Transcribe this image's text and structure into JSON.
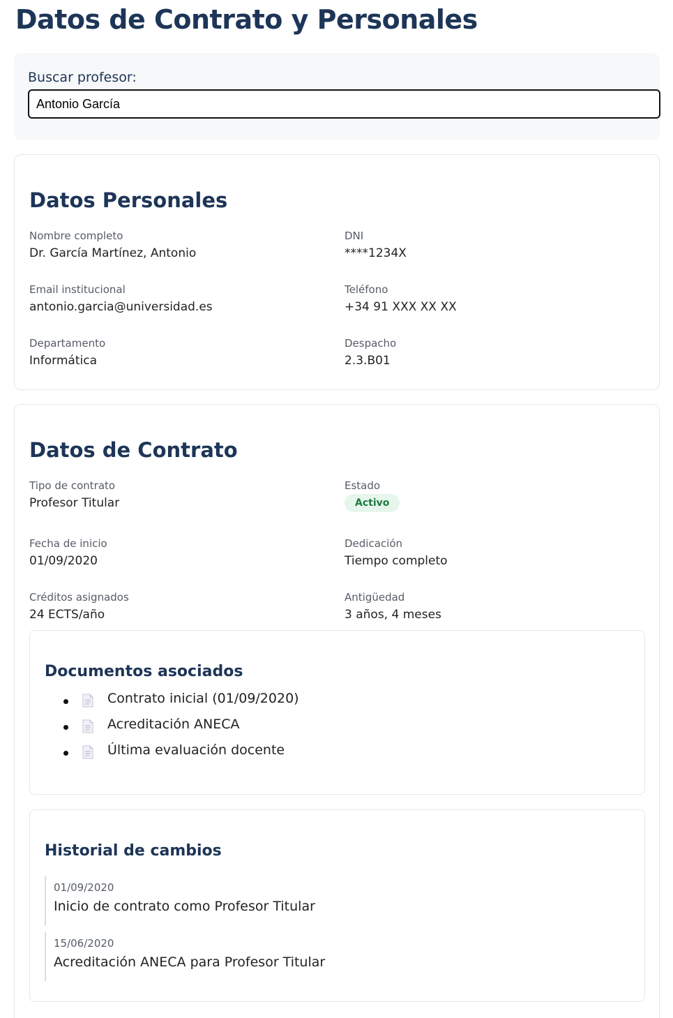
{
  "page": {
    "title": "Datos de Contrato y Personales"
  },
  "search": {
    "label": "Buscar profesor:",
    "value": "Antonio García"
  },
  "personal": {
    "title": "Datos Personales",
    "fields": [
      {
        "label": "Nombre completo",
        "value": "Dr. García Martínez, Antonio"
      },
      {
        "label": "DNI",
        "value": "****1234X"
      },
      {
        "label": "Email institucional",
        "value": "antonio.garcia@universidad.es"
      },
      {
        "label": "Teléfono",
        "value": "+34 91 XXX XX XX"
      },
      {
        "label": "Departamento",
        "value": "Informática"
      },
      {
        "label": "Despacho",
        "value": "2.3.B01"
      }
    ]
  },
  "contract": {
    "title": "Datos de Contrato",
    "tipo": {
      "label": "Tipo de contrato",
      "value": "Profesor Titular"
    },
    "estado": {
      "label": "Estado",
      "value": "Activo",
      "color": "#1f7a3f",
      "background": "#e6f6ec"
    },
    "fecha": {
      "label": "Fecha de inicio",
      "value": "01/09/2020"
    },
    "dedicacion": {
      "label": "Dedicación",
      "value": "Tiempo completo"
    },
    "creditos": {
      "label": "Créditos asignados",
      "value": "24 ECTS/año"
    },
    "antiguedad": {
      "label": "Antigüedad",
      "value": "3 años, 4 meses"
    }
  },
  "documents": {
    "title": "Documentos asociados",
    "icon": "document-icon",
    "items": [
      {
        "label": "Contrato inicial (01/09/2020)"
      },
      {
        "label": "Acreditación ANECA"
      },
      {
        "label": "Última evaluación docente"
      }
    ]
  },
  "history": {
    "title": "Historial de cambios",
    "entries": [
      {
        "date": "01/09/2020",
        "text": "Inicio de contrato como Profesor Titular"
      },
      {
        "date": "15/06/2020",
        "text": "Acreditación ANECA para Profesor Titular"
      }
    ]
  },
  "colors": {
    "heading": "#1d3557",
    "border": "#e3e6ea",
    "search_bg": "#f7f8fa"
  }
}
